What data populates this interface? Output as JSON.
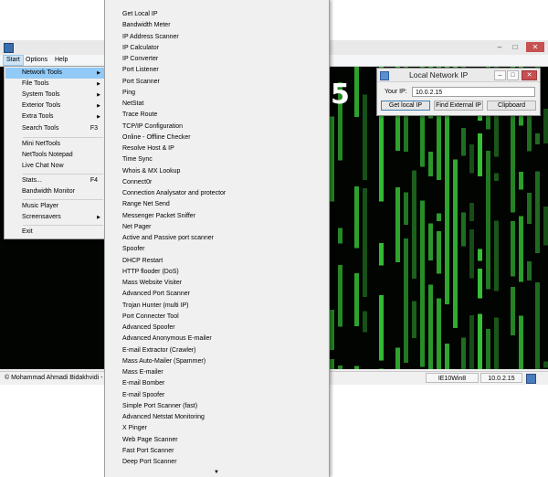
{
  "colors": {
    "matrix_green": "#3bd43b",
    "menu_highlight": "#91c9f7",
    "close_button": "#c75050"
  },
  "window": {
    "minimize_icon": "minimize-icon",
    "maximize_icon": "maximize-icon",
    "close_icon": "close-icon"
  },
  "menubar": {
    "items": [
      "Start",
      "Options",
      "Help"
    ]
  },
  "start_menu": {
    "items": [
      {
        "label": "Network Tools",
        "arrow": "▶"
      },
      {
        "label": "File Tools",
        "arrow": "▶"
      },
      {
        "label": "System Tools",
        "arrow": "▶"
      },
      {
        "label": "Exterior Tools",
        "arrow": "▶"
      },
      {
        "label": "Extra Tools",
        "arrow": "▶"
      },
      {
        "label": "Search Tools",
        "shortcut": "F3"
      },
      {
        "label": "Mini NetTools"
      },
      {
        "label": "NetTools Notepad"
      },
      {
        "label": "Live Chat Now"
      },
      {
        "label": "Stats...",
        "shortcut": "F4"
      },
      {
        "label": "Bandwidth Monitor"
      },
      {
        "label": "Music Player"
      },
      {
        "label": "Screensavers",
        "arrow": "▶"
      },
      {
        "label": "Exit"
      }
    ]
  },
  "network_submenu": {
    "items": [
      "Get Local IP",
      "Bandwidth Meter",
      "IP Address Scanner",
      "IP Calculator",
      "IP Converter",
      "Port Listener",
      "Port Scanner",
      "Ping",
      "NetStat",
      "Trace Route",
      "TCP/IP Configuration",
      "Online - Offline Checker",
      "Resolve Host & IP",
      "Time Sync",
      "Whois & MX Lookup",
      "Connect0r",
      "Connection Analysator and protector",
      "Range Net Send",
      "Messenger Packet Sniffer",
      "Net Pager",
      "Active and Passive port scanner",
      "Spoofer",
      "DHCP Restart",
      "HTTP flooder (DoS)",
      "Mass Website Visiter",
      "Advanced Port Scanner",
      "Trojan Hunter (multi IP)",
      "Port Connecter Tool",
      "Advanced Spoofer",
      "Advanced Anonymous E-mailer",
      "E-mail Extractor (Crawler)",
      "Mass Auto-Mailer (Spammer)",
      "Mass E-mailer",
      "E-mail Bomber",
      "E-mail Spoofer",
      "Simple Port Scanner (fast)",
      "Advanced Netstat Monitoring",
      "X Pinger",
      "Web Page Scanner",
      "Fast Port Scanner",
      "Deep Port Scanner"
    ],
    "more_arrow": "▼"
  },
  "overlay_number": "5",
  "local_ip_window": {
    "title": "Local Network IP",
    "your_ip_label": "Your IP:",
    "ip_value": "10.0.2.15",
    "buttons": [
      "Get local IP",
      "Find External IP",
      "Clipboard"
    ]
  },
  "statusbar": {
    "credit": "© Mohammad Ahmadi Bidakhvidi - ww",
    "os": "IE10Win8",
    "ip": "10.0.2.15"
  }
}
